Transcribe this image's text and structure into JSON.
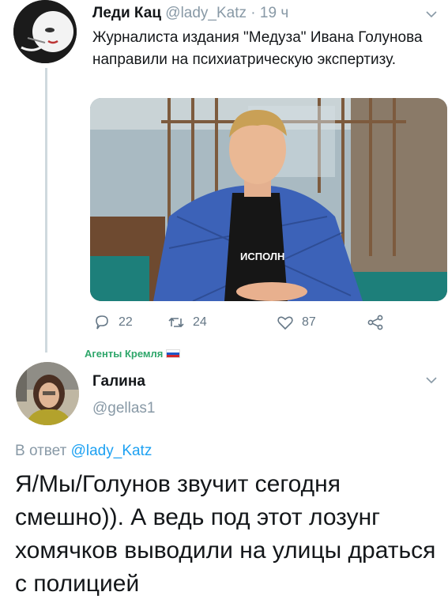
{
  "tweet": {
    "display_name": "Леди Кац",
    "handle": "@lady_Katz",
    "separator": " · ",
    "time": "19 ч",
    "text": "Журналиста издания \"Медуза\" Ивана Голунова направили на психиатрическую экспертизу.",
    "photo_shirt_text": "ИСПОЛН",
    "reply_count": "22",
    "retweet_count": "24",
    "like_count": "87",
    "channel_tag": "Агенты Кремля"
  },
  "reply": {
    "display_name": "Галина",
    "handle": "@gellas1",
    "replying_prefix": "В ответ ",
    "replying_to": "@lady_Katz",
    "text": "Я/Мы/Голунов звучит сегодня смешно)). А ведь под этот лозунг хомячков выводили на улицы драться с полицией"
  },
  "icons": {
    "reply": "speech-bubble-icon",
    "retweet": "retweet-icon",
    "like": "heart-icon",
    "share": "share-nodes-icon",
    "more": "chevron-down-icon"
  },
  "colors": {
    "text": "#14171a",
    "muted": "#8899a6",
    "link": "#1da1f2",
    "channel_tag": "#2ea66a"
  }
}
